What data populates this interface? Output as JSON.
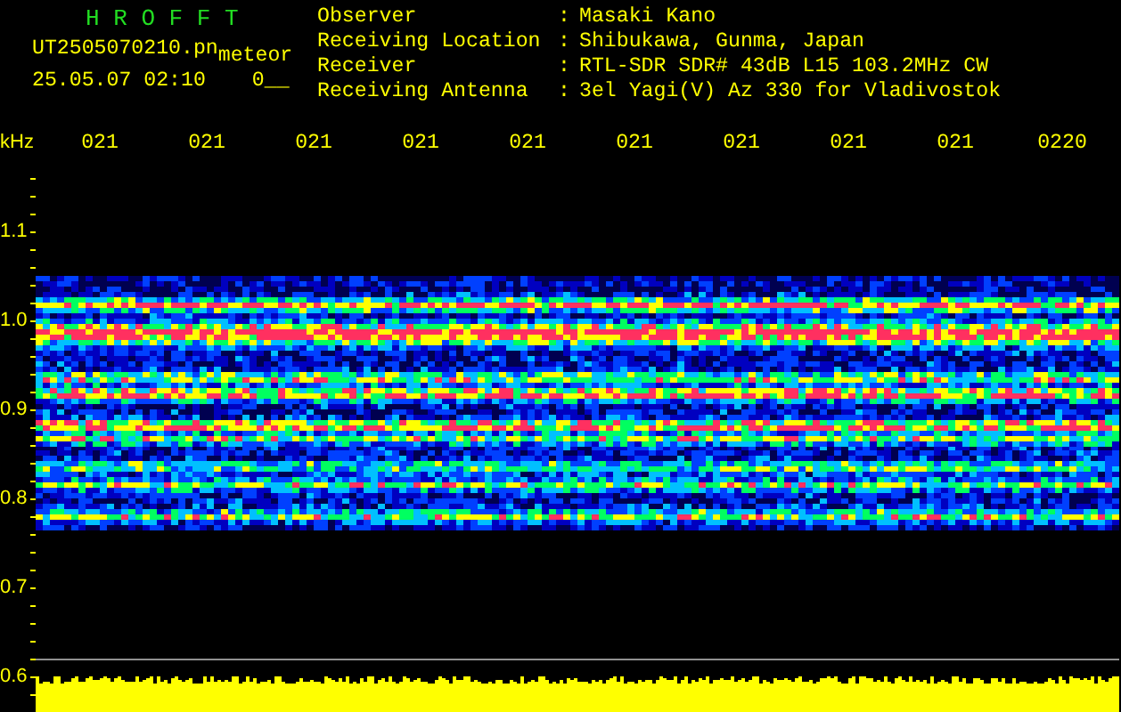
{
  "header": {
    "app_title": "H R O F F T",
    "file_name": "UT2505070210.pn",
    "mode": "meteor",
    "datetime": "25.05.07 02:10",
    "counter": "0__"
  },
  "info": [
    {
      "label": "Observer",
      "separator": ":",
      "value": "Masaki Kano"
    },
    {
      "label": "Receiving Location",
      "separator": ":",
      "value": "Shibukawa, Gunma, Japan"
    },
    {
      "label": "Receiver",
      "separator": ":",
      "value": "RTL-SDR SDR# 43dB L15 103.2MHz CW"
    },
    {
      "label": "Receiving Antenna",
      "separator": ":",
      "value": "3el Yagi(V) Az 330 for Vladivostok"
    }
  ],
  "axis": {
    "unit": "kHz",
    "x_labels": [
      "021",
      "021",
      "021",
      "021",
      "021",
      "021",
      "021",
      "021",
      "021",
      "0220"
    ],
    "y_labels": [
      "1.1",
      "1.0",
      "0.9",
      "0.8",
      "0.7",
      "0.6"
    ]
  }
}
